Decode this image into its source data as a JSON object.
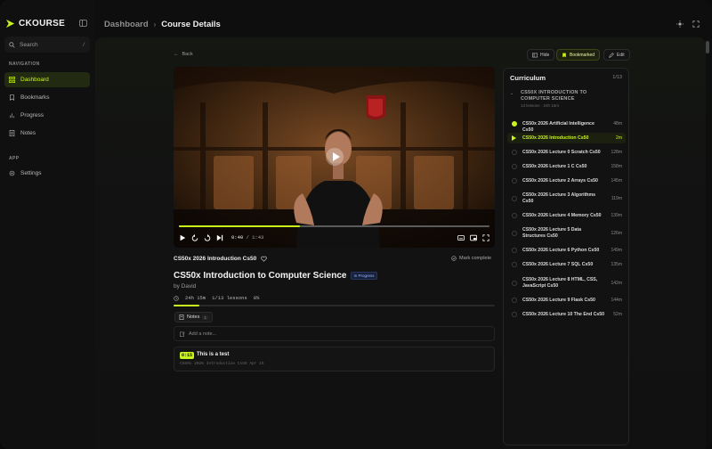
{
  "app": {
    "name": "CKOURSE",
    "accent": "#c9f31d"
  },
  "search": {
    "placeholder": "Search",
    "shortcut": "/"
  },
  "sidebar": {
    "nav_section": "NAVIGATION",
    "nav": [
      {
        "label": "Dashboard",
        "icon": "grid-icon",
        "active": true
      },
      {
        "label": "Bookmarks",
        "icon": "bookmark-icon"
      },
      {
        "label": "Progress",
        "icon": "bar-chart-icon"
      },
      {
        "label": "Notes",
        "icon": "note-icon"
      }
    ],
    "app_section": "APP",
    "app_items": [
      {
        "label": "Settings",
        "icon": "gear-icon"
      }
    ]
  },
  "breadcrumb": {
    "parent": "Dashboard",
    "current": "Course Details",
    "separator": "›"
  },
  "toolbar": {
    "back": "Back",
    "hide": "Hide",
    "bookmarked": "Bookmarked",
    "edit": "Edit"
  },
  "player": {
    "current_time": "0:40",
    "duration": "1:43",
    "progress": 0.39
  },
  "lesson": {
    "title": "CS50x 2026 Introduction Cs50",
    "mark_complete": "Mark complete"
  },
  "course": {
    "title": "CS50x Introduction to Computer Science",
    "status": "In Progress",
    "author": "by David",
    "duration": "24h 15m",
    "lessons": "1/13 lessons",
    "percent": "8%",
    "progress": 0.08
  },
  "notes": {
    "tab_label": "Notes",
    "count": "1",
    "placeholder": "Add a note...",
    "items": [
      {
        "timestamp": "0:15",
        "text": "This is a test",
        "meta": "CS50x 2026 Introduction Cs50 Apr 15"
      }
    ]
  },
  "curriculum": {
    "title": "Curriculum",
    "count": "1/13",
    "section": {
      "title": "CS50X INTRODUCTION TO COMPUTER SCIENCE",
      "meta": "13 lessons · 24h 15m"
    },
    "lessons": [
      {
        "title": "CS50x 2026 Artificial Intelligence Cs50",
        "duration": "48m",
        "state": "done"
      },
      {
        "title": "CS50x 2026 Introduction Cs50",
        "duration": "2m",
        "state": "playing"
      },
      {
        "title": "CS50x 2026 Lecture 0 Scratch Cs50",
        "duration": "128m",
        "state": "todo"
      },
      {
        "title": "CS50x 2026 Lecture 1 C Cs50",
        "duration": "158m",
        "state": "todo"
      },
      {
        "title": "CS50x 2026 Lecture 2 Arrays Cs50",
        "duration": "145m",
        "state": "todo"
      },
      {
        "title": "CS50x 2026 Lecture 3 Algorithms Cs50",
        "duration": "119m",
        "state": "todo"
      },
      {
        "title": "CS50x 2026 Lecture 4 Memory Cs50",
        "duration": "139m",
        "state": "todo"
      },
      {
        "title": "CS50x 2026 Lecture 5 Data Structures Cs50",
        "duration": "126m",
        "state": "todo"
      },
      {
        "title": "CS50x 2026 Lecture 6 Python Cs50",
        "duration": "149m",
        "state": "todo"
      },
      {
        "title": "CS50x 2026 Lecture 7 SQL Cs50",
        "duration": "135m",
        "state": "todo"
      },
      {
        "title": "CS50x 2026 Lecture 8 HTML, CSS, JavaScript Cs50",
        "duration": "142m",
        "state": "todo"
      },
      {
        "title": "CS50x 2026 Lecture 9 Flask Cs50",
        "duration": "144m",
        "state": "todo"
      },
      {
        "title": "CS50x 2026 Lecture 10 The End Cs50",
        "duration": "52m",
        "state": "todo"
      }
    ]
  }
}
